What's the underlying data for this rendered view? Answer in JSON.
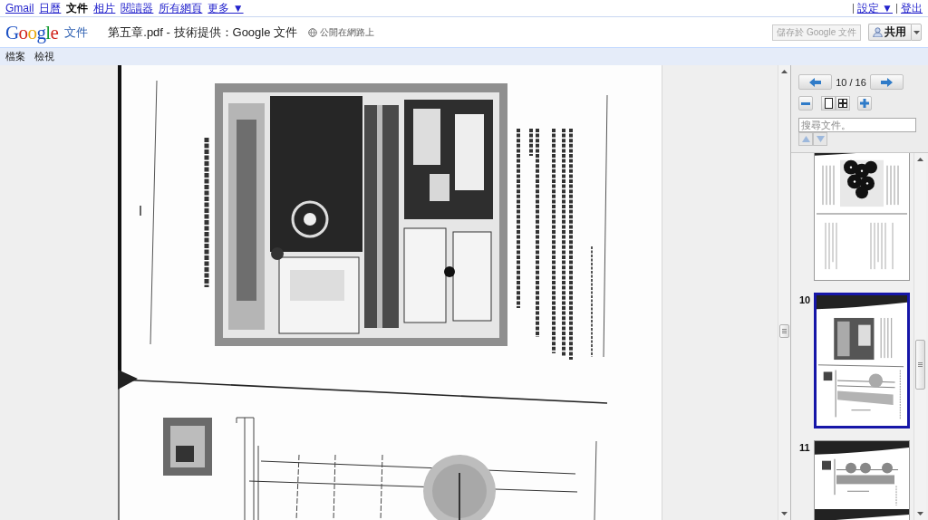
{
  "top_bar": {
    "links": [
      {
        "label": "Gmail",
        "selected": false
      },
      {
        "label": "日曆",
        "selected": false
      },
      {
        "label": "文件",
        "selected": true
      },
      {
        "label": "相片",
        "selected": false
      },
      {
        "label": "閱讀器",
        "selected": false
      },
      {
        "label": "所有網頁",
        "selected": false
      },
      {
        "label": "更多 ▼",
        "selected": false
      }
    ],
    "account_links": [
      "設定 ▼",
      "登出"
    ]
  },
  "header": {
    "logo": "Google",
    "product": "文件",
    "document_title": "第五章.pdf - 技術提供：Google 文件",
    "visibility": "公開在網路上",
    "buttons": [
      {
        "label": "儲存於 Google 文件",
        "kind": "save",
        "disabled": true
      },
      {
        "label": "共用",
        "kind": "share",
        "disabled": false
      }
    ]
  },
  "menu_bar": {
    "items": [
      "檔案",
      "檢視"
    ]
  },
  "viewer": {
    "page_indicator": "10 / 16",
    "search": {
      "placeholder": "搜尋文件。",
      "result_buttons_disabled": true
    },
    "thumbnails": [
      {
        "selected": false
      },
      {
        "number": "10",
        "selected": true
      },
      {
        "number": "11",
        "selected": false
      }
    ]
  }
}
